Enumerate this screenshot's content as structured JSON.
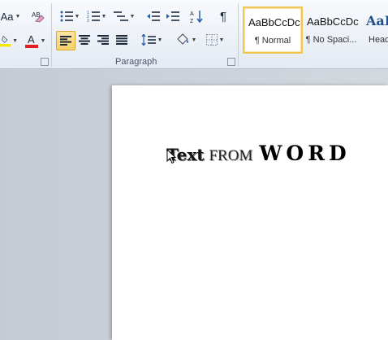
{
  "font_group": {
    "change_case_label": "Aa"
  },
  "paragraph_group": {
    "label": "Paragraph",
    "pilcrow": "¶"
  },
  "styles_group": {
    "items": [
      {
        "sample": "AaBbCcDc",
        "name": "¶ Normal"
      },
      {
        "sample": "AaBbCcDc",
        "name": "¶ No Spaci..."
      },
      {
        "sample": "AaB",
        "name": "Head"
      }
    ]
  },
  "document": {
    "words": [
      "Text",
      "FROM",
      "WORD"
    ]
  },
  "colors": {
    "highlight": "#f7e600",
    "font_color": "#e02020",
    "active_button": "#f8cf6a",
    "heading_style_blue": "#1f4e8c"
  }
}
